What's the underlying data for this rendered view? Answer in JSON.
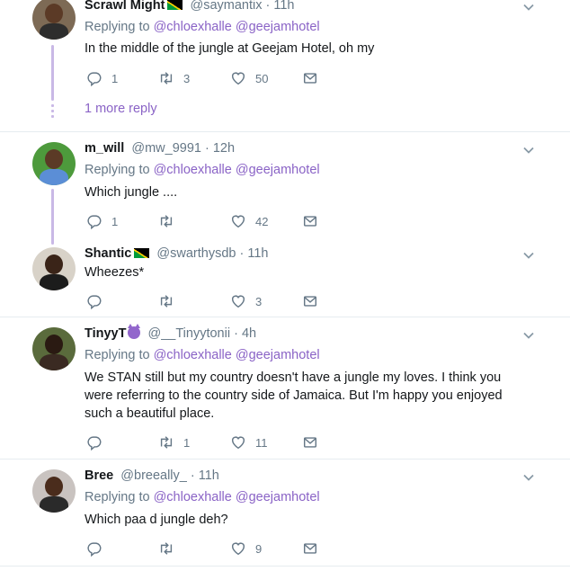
{
  "replying_label": "Replying to",
  "more_replies": "1 more reply",
  "colors": {
    "accent": "#8a63c6",
    "text": "#14171a",
    "muted": "#657786",
    "thread": "#c9b8e6"
  },
  "tweets": [
    {
      "name": "Scrawl Might",
      "handle": "@saymantix",
      "time": "· 11h",
      "mentions": [
        "@chloexhalle",
        "@geejamhotel"
      ],
      "text": "In the middle of the jungle at Geejam Hotel, oh my",
      "replies": "1",
      "retweets": "3",
      "likes": "50"
    },
    {
      "name": "m_will",
      "handle": "@mw_9991",
      "time": "· 12h",
      "mentions": [
        "@chloexhalle",
        "@geejamhotel"
      ],
      "text": "Which jungle ....",
      "replies": "1",
      "retweets": "",
      "likes": "42"
    },
    {
      "name": "Shantic",
      "handle": "@swarthysdb",
      "time": "· 11h",
      "text": "Wheezes*",
      "replies": "",
      "retweets": "",
      "likes": "3"
    },
    {
      "name": "TinyyT",
      "handle": "@__Tinyytonii",
      "time": "· 4h",
      "mentions": [
        "@chloexhalle",
        "@geejamhotel"
      ],
      "text": "We STAN still but my country doesn't have a jungle my loves. I think you were referring to the country side of Jamaica. But I'm happy you enjoyed such a beautiful place.",
      "replies": "",
      "retweets": "1",
      "likes": "11"
    },
    {
      "name": "Bree",
      "handle": "@breeally_",
      "time": "· 11h",
      "mentions": [
        "@chloexhalle",
        "@geejamhotel"
      ],
      "text": "Which paa d jungle deh?",
      "replies": "",
      "retweets": "",
      "likes": "9"
    }
  ]
}
